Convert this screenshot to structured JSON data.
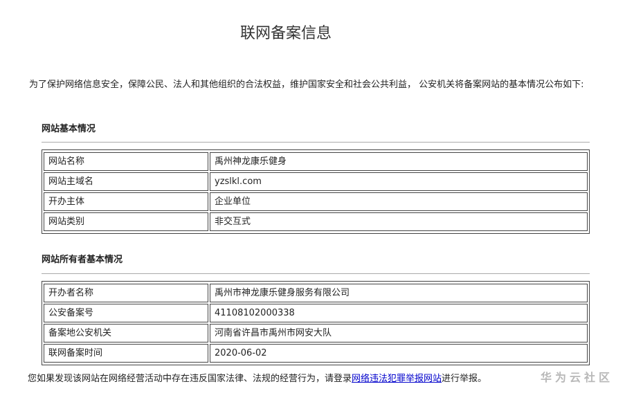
{
  "page": {
    "title": "联网备案信息",
    "intro": "为了保护网络信息安全，保障公民、法人和其他组织的合法权益，维护国家安全和社会公共利益， 公安机关将备案网站的基本情况公布如下:"
  },
  "site_section": {
    "title": "网站基本情况",
    "rows": [
      {
        "label": "网站名称",
        "value": "禹州神龙康乐健身"
      },
      {
        "label": "网站主域名",
        "value": "yzslkl.com"
      },
      {
        "label": "开办主体",
        "value": "企业单位"
      },
      {
        "label": "网站类别",
        "value": "非交互式"
      }
    ]
  },
  "owner_section": {
    "title": "网站所有者基本情况",
    "rows": [
      {
        "label": "开办者名称",
        "value": "禹州市神龙康乐健身服务有限公司"
      },
      {
        "label": "公安备案号",
        "value": "41108102000338"
      },
      {
        "label": "备案地公安机关",
        "value": "河南省许昌市禹州市网安大队"
      },
      {
        "label": "联网备案时间",
        "value": "2020-06-02"
      }
    ]
  },
  "footer": {
    "text_before": "您如果发现该网站在网络经营活动中存在违反国家法律、法规的经营行为，请登录",
    "link_text": "网络违法犯罪举报网站",
    "text_after": "进行举报。"
  },
  "watermark": {
    "text": "华为云社区"
  }
}
